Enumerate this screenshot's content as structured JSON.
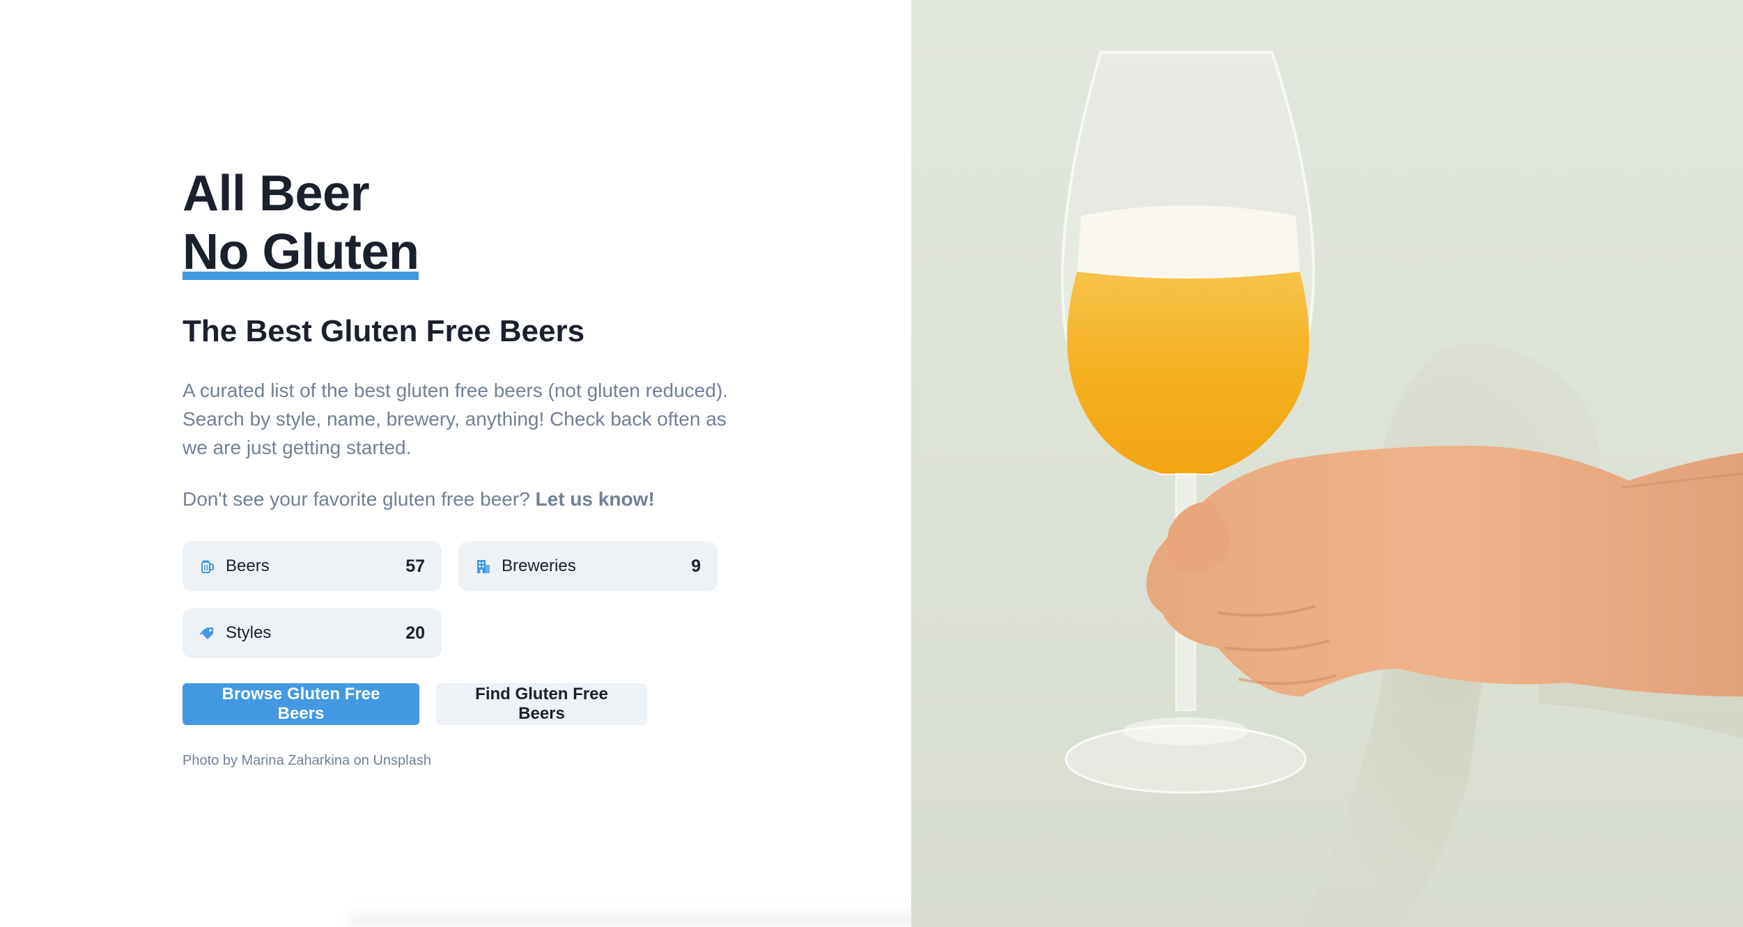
{
  "hero": {
    "title_line1": "All Beer",
    "title_line2": "No Gluten",
    "subtitle": "The Best Gluten Free Beers",
    "description": "A curated list of the best gluten free beers (not gluten reduced). Search by style, name, brewery, anything! Check back often as we are just getting started.",
    "ask_text": "Don't see your favorite gluten free beer?",
    "ask_link": "Let us know!"
  },
  "stats": [
    {
      "icon": "beer-mug-icon",
      "label": "Beers",
      "count": "57"
    },
    {
      "icon": "building-icon",
      "label": "Breweries",
      "count": "9"
    },
    {
      "icon": "tag-icon",
      "label": "Styles",
      "count": "20"
    }
  ],
  "buttons": {
    "browse_label": "Browse Gluten Free Beers",
    "find_label": "Find Gluten Free Beers"
  },
  "credit": "Photo by Marina Zaharkina on Unsplash",
  "colors": {
    "accent": "#4299e1",
    "text_dark": "#1a202c",
    "text_muted": "#718096",
    "chip_bg": "#edf2f7",
    "beer": "#f5b01f",
    "background_photo": "#dfe4d9"
  }
}
